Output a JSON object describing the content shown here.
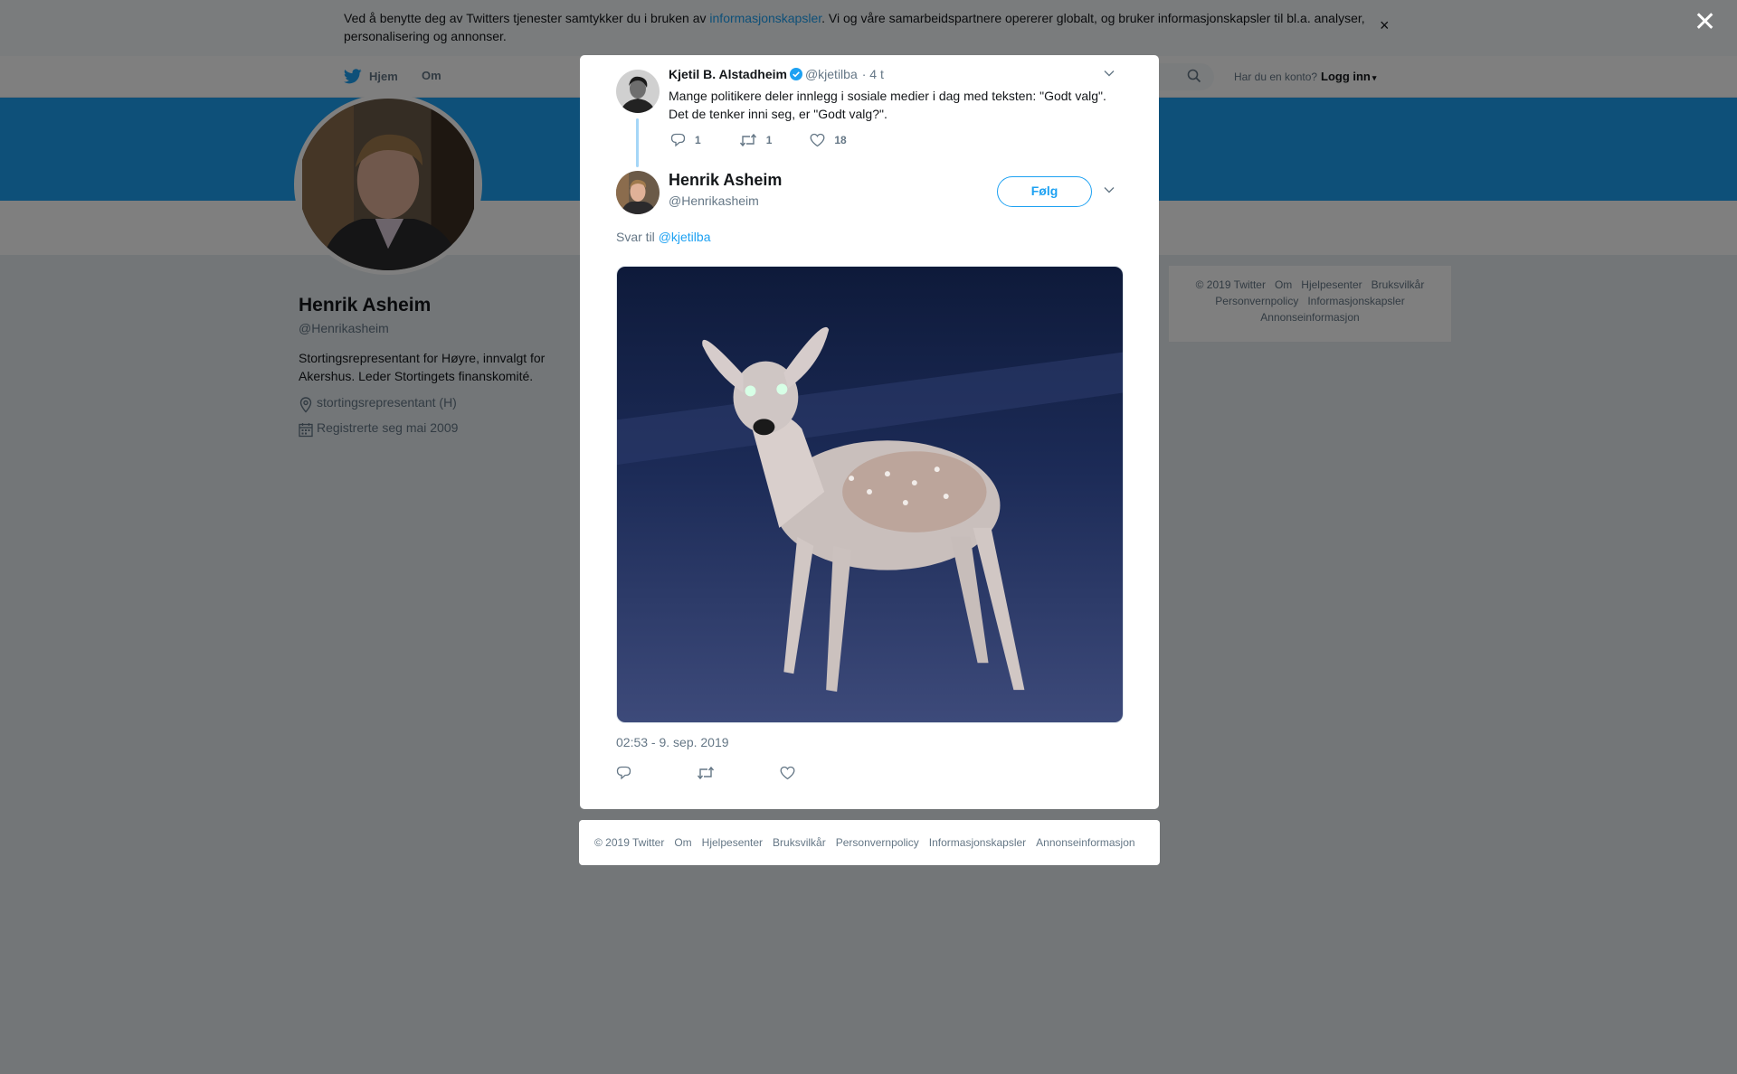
{
  "cookie": {
    "text_before": "Ved å benytte deg av Twitters tjenester samtykker du i bruken av ",
    "link": "informasjonskapsler",
    "text_after": ". Vi og våre samarbeidspartnere opererer globalt, og bruker informasjonskapsler til bl.a. analyser, personalisering og annonser.",
    "close": "×"
  },
  "nav": {
    "home": "Hjem",
    "about": "Om",
    "login_question": "Har du en konto?",
    "login": "Logg inn"
  },
  "profile": {
    "name": "Henrik Asheim",
    "handle": "@Henrikasheim",
    "bio": "Stortingsrepresentant for Høyre, innvalgt for Akershus. Leder Stortingets finanskomité.",
    "location": "stortingsrepresentant (H)",
    "joined": "Registrerte seg mai 2009"
  },
  "side_footer": [
    "© 2019 Twitter",
    "Om",
    "Hjelpesenter",
    "Bruksvilkår",
    "Personvernpolicy",
    "Informasjonskapsler",
    "Annonseinformasjon"
  ],
  "overlay_close": "✕",
  "tweet1": {
    "name": "Kjetil B. Alstadheim",
    "handle": "@kjetilba",
    "time": "· 4 t",
    "text": "Mange politikere deler innlegg i sosiale medier i dag med teksten: \"Godt valg\". Det de tenker inni seg, er \"Godt valg?\".",
    "replies": "1",
    "retweets": "1",
    "likes": "18"
  },
  "tweet2": {
    "name": "Henrik Asheim",
    "handle": "@Henrikasheim",
    "follow": "Følg",
    "reply_prefix": "Svar til ",
    "reply_mention": "@kjetilba",
    "timestamp": "02:53 - 9. sep. 2019"
  },
  "bottom_footer": [
    "© 2019 Twitter",
    "Om",
    "Hjelpesenter",
    "Bruksvilkår",
    "Personvernpolicy",
    "Informasjonskapsler",
    "Annonseinformasjon"
  ],
  "icons": {
    "bird": "twitter-bird-icon",
    "search": "search-icon",
    "location": "location-pin-icon",
    "calendar": "calendar-icon",
    "verified": "verified-badge-icon",
    "reply": "reply-icon",
    "retweet": "retweet-icon",
    "like": "heart-icon",
    "caret": "chevron-down-icon"
  },
  "colors": {
    "accent": "#1da1f2",
    "thread_line": "#a5d6f7",
    "muted_text": "#657786"
  }
}
